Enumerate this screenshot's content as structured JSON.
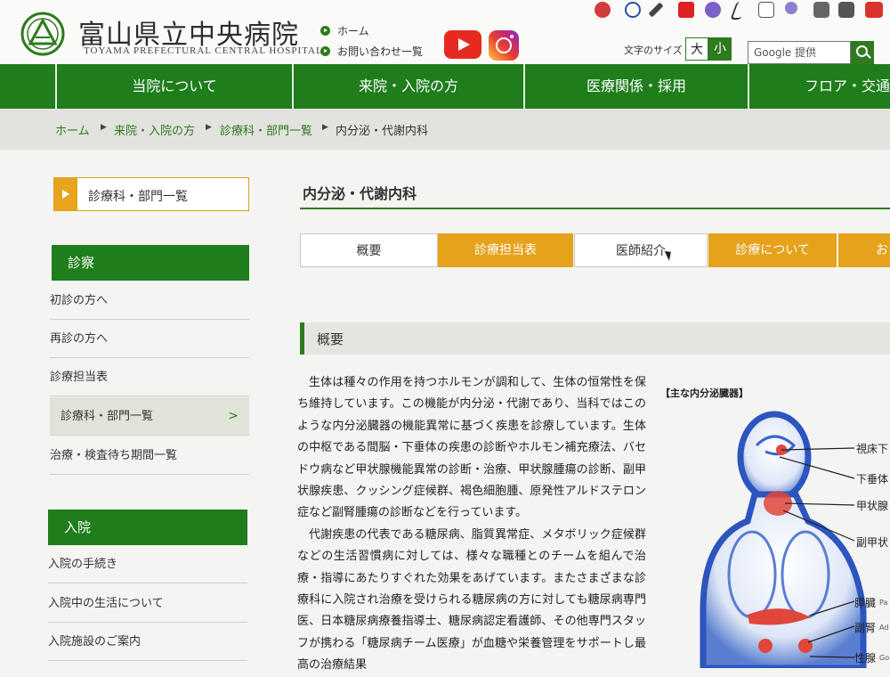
{
  "header": {
    "logo_jp": "富山県立中央病院",
    "logo_en": "TOYAMA PREFECTURAL CENTRAL HOSPITAL",
    "links": [
      "ホーム",
      "お問い合わせ一覧"
    ],
    "font_size_label": "文字のサイズ",
    "font_size_large": "大",
    "font_size_small": "小",
    "search_placeholder": "Google 提供",
    "social_icons": [
      "youtube-icon",
      "instagram-icon"
    ],
    "accent_color": "#1f7d1c",
    "gold_color": "#e6a21a"
  },
  "nav": [
    "当院について",
    "来院・入院の方",
    "医療関係・採用",
    "フロア・交通案"
  ],
  "breadcrumb": {
    "items": [
      "ホーム",
      "来院・入院の方",
      "診療科・部門一覧"
    ],
    "current": "内分泌・代謝内科"
  },
  "sidebar": {
    "title": "診療科・部門一覧",
    "sections": [
      {
        "heading": "診察",
        "items": [
          "初診の方へ",
          "再診の方へ",
          "診療担当表",
          "診療科・部門一覧",
          "治療・検査待ち期間一覧"
        ]
      },
      {
        "heading": "入院",
        "items": [
          "入院の手続き",
          "入院中の生活について",
          "入院施設のご案内"
        ]
      }
    ]
  },
  "main": {
    "title": "内分泌・代謝内科",
    "tabs": [
      "概要",
      "診療担当表",
      "医師紹介",
      "診療について",
      "お"
    ],
    "section_heading": "概要",
    "paragraph1": "生体は種々の作用を持つホルモンが調和して、生体の恒常性を保ち維持しています。この機能が内分泌・代謝であり、当科ではこのような内分泌臓器の機能異常に基づく疾患を診療しています。生体の中枢である間脳・下垂体の疾患の診断やホルモン補充療法、バセドウ病など甲状腺機能異常の診断・治療、甲状腺腫瘍の診断、副甲状腺疾患、クッシング症候群、褐色細胞腫、原発性アルドステロン症など副腎腫瘍の診断などを行っています。",
    "paragraph2": "代謝疾患の代表である糖尿病、脂質異常症、メタボリック症候群などの生活習慣病に対しては、様々な職種とのチームを組んで治療・指導にあたりすぐれた効果をあげています。またさまざまな診療科に入院され治療を受けられる糖尿病の方に対しても糖尿病専門医、日本糖尿病療養指導士、糖尿病認定看護師、その他専門スタッフが携わる「糖尿病チーム医療」が血糖や栄養管理をサポートし最高の治療結果",
    "figure": {
      "caption": "【主な内分泌臓器】",
      "labels": [
        "視床下",
        "下垂体",
        "甲状腺",
        "副甲状",
        "膵臓",
        "副腎",
        "性腺"
      ],
      "small_labels": [
        "Pa",
        "Ad",
        "Go"
      ]
    }
  }
}
